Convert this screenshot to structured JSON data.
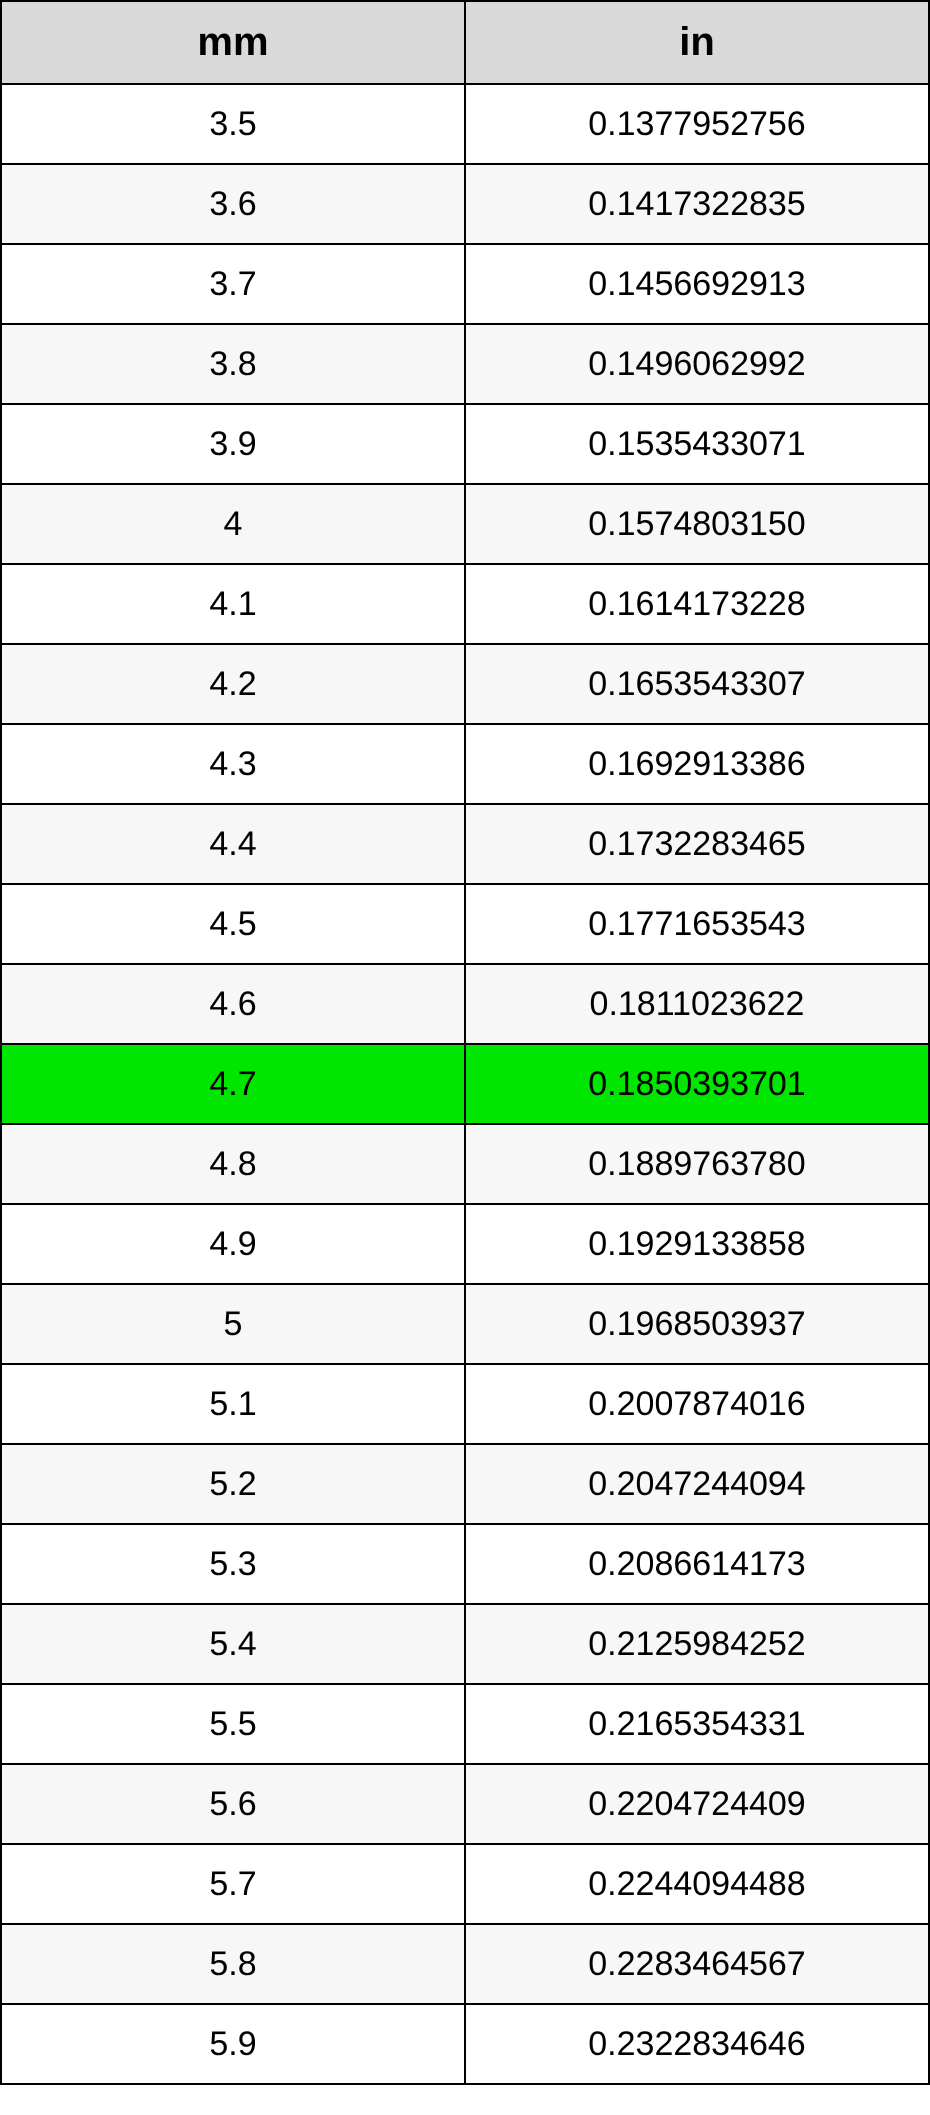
{
  "chart_data": {
    "type": "table",
    "title": "",
    "columns": [
      "mm",
      "in"
    ],
    "highlight_row_index": 12,
    "rows": [
      {
        "mm": "3.5",
        "in": "0.1377952756"
      },
      {
        "mm": "3.6",
        "in": "0.1417322835"
      },
      {
        "mm": "3.7",
        "in": "0.1456692913"
      },
      {
        "mm": "3.8",
        "in": "0.1496062992"
      },
      {
        "mm": "3.9",
        "in": "0.1535433071"
      },
      {
        "mm": "4",
        "in": "0.1574803150"
      },
      {
        "mm": "4.1",
        "in": "0.1614173228"
      },
      {
        "mm": "4.2",
        "in": "0.1653543307"
      },
      {
        "mm": "4.3",
        "in": "0.1692913386"
      },
      {
        "mm": "4.4",
        "in": "0.1732283465"
      },
      {
        "mm": "4.5",
        "in": "0.1771653543"
      },
      {
        "mm": "4.6",
        "in": "0.1811023622"
      },
      {
        "mm": "4.7",
        "in": "0.1850393701"
      },
      {
        "mm": "4.8",
        "in": "0.1889763780"
      },
      {
        "mm": "4.9",
        "in": "0.1929133858"
      },
      {
        "mm": "5",
        "in": "0.1968503937"
      },
      {
        "mm": "5.1",
        "in": "0.2007874016"
      },
      {
        "mm": "5.2",
        "in": "0.2047244094"
      },
      {
        "mm": "5.3",
        "in": "0.2086614173"
      },
      {
        "mm": "5.4",
        "in": "0.2125984252"
      },
      {
        "mm": "5.5",
        "in": "0.2165354331"
      },
      {
        "mm": "5.6",
        "in": "0.2204724409"
      },
      {
        "mm": "5.7",
        "in": "0.2244094488"
      },
      {
        "mm": "5.8",
        "in": "0.2283464567"
      },
      {
        "mm": "5.9",
        "in": "0.2322834646"
      }
    ]
  }
}
